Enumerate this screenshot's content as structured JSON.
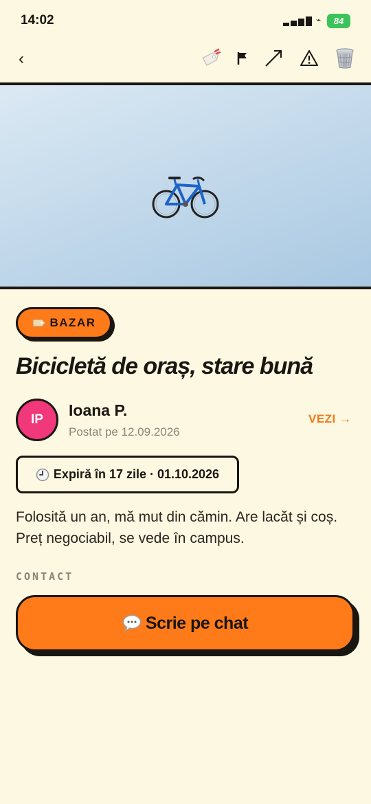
{
  "status_bar": {
    "time": "14:02",
    "battery": "84"
  },
  "toolbar": {
    "back_label": "‹",
    "icons": [
      "tag-icon",
      "flag-icon",
      "share-icon",
      "warning-icon",
      "trash-icon"
    ]
  },
  "hero": {
    "image": "bicycle-icon",
    "bg_colors": [
      "#dbe9f3",
      "#a9c8e2"
    ]
  },
  "listing": {
    "category": "BAZAR",
    "title": "Bicicletă de oraș, stare bună",
    "author": {
      "initials": "IP",
      "name": "Ioana P.",
      "posted": "Postat pe 12.09.2026",
      "view_link": "VEZI →"
    },
    "expiry": "Expiră în 17 zile · 01.10.2026",
    "description": "Folosită un an, mă mut din cămin. Are lacăt și coș. Preț negociabil, se vede în campus."
  },
  "contact": {
    "label": "CONTACT",
    "chat_button": "Scrie pe chat"
  },
  "colors": {
    "background": "#fcf8e1",
    "accent": "#ff7b1a",
    "avatar": "#f0387a",
    "link": "#f07a16",
    "ink": "#1a1612",
    "battery": "#3cc45a"
  }
}
